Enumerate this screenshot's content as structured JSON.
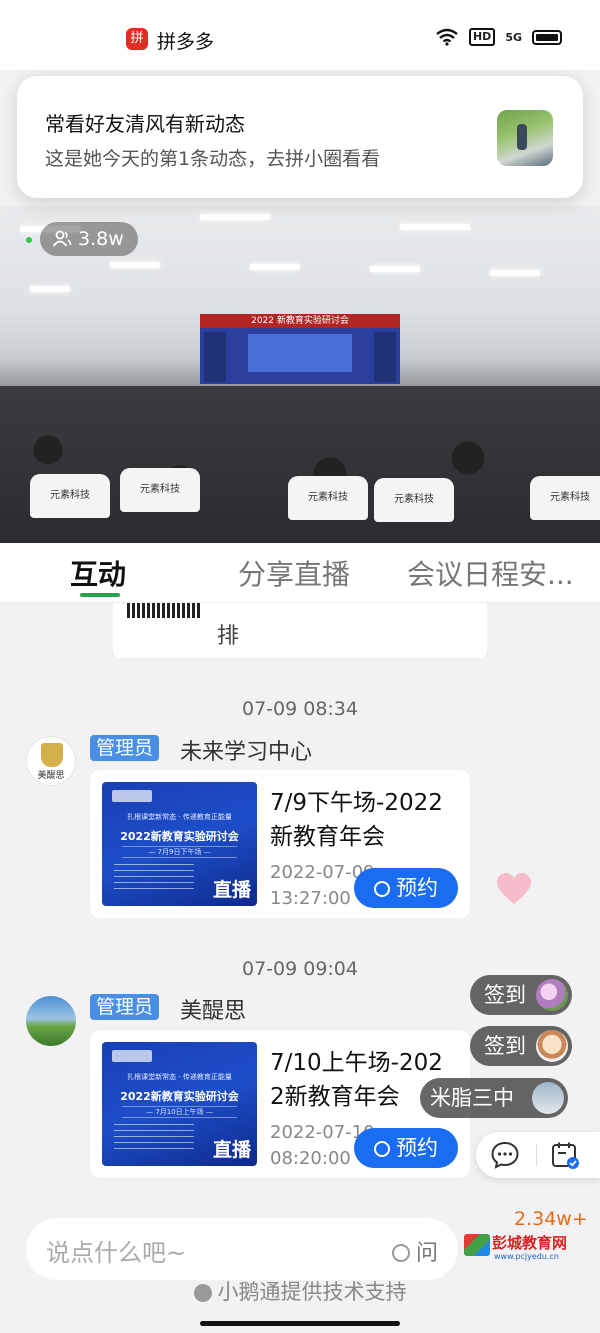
{
  "status_bar": {
    "app_name": "拼多多",
    "app_badge": "拼",
    "hd": "HD",
    "network": "5G"
  },
  "notification": {
    "title": "常看好友清风有新动态",
    "body": "这是她今天的第1条动态，去拼小圈看看"
  },
  "video": {
    "viewers": "3.8w",
    "stage_banner": "2022 新教育实验研讨会",
    "seat_brand": "元素科技"
  },
  "tabs": [
    {
      "label": "互动",
      "active": true
    },
    {
      "label": "分享直播",
      "active": false
    },
    {
      "label": "会议日程安..."
    }
  ],
  "partial_card": {
    "text": "排"
  },
  "messages": [
    {
      "time": "07-09 08:34",
      "role": "管理员",
      "sender": "未来学习中心",
      "avatar_text": "美醍思",
      "poster_sub": "扎根课堂新常态 · 传递教育正能量",
      "poster_title": "2022新教育实验研讨会",
      "poster_date": "— 7月9日下午场 —",
      "poster_live": "直播",
      "title": "7/9下午场-2022新教育年会",
      "date": "2022-07-09 13:27:00",
      "reserve": "预约"
    },
    {
      "time": "07-09 09:04",
      "role": "管理员",
      "sender": "美醍思",
      "poster_sub": "扎根课堂新常态 · 传递教育正能量",
      "poster_title": "2022新教育实验研讨会",
      "poster_date": "— 7月10日上午场 —",
      "poster_live": "直播",
      "title": "7/10上午场-2022新教育年会",
      "date": "2022-07-10 08:20:00",
      "reserve": "预约"
    }
  ],
  "overlays": {
    "checkin_1": "签到",
    "checkin_2": "签到",
    "flyer": "米脂三中"
  },
  "bottom": {
    "input_placeholder": "说点什么吧~",
    "ask": "问",
    "likes": "2.34w+",
    "support": "小鹅通提供技术支持",
    "watermark_name": "彭城教育网",
    "watermark_url": "www.pcjyedu.cn"
  },
  "colors": {
    "accent_green": "#2aa14a",
    "admin_blue": "#4a8fe6",
    "reserve_blue": "#1a6cf0",
    "like_orange": "#e36c1a",
    "pdd_red": "#e02e24"
  }
}
